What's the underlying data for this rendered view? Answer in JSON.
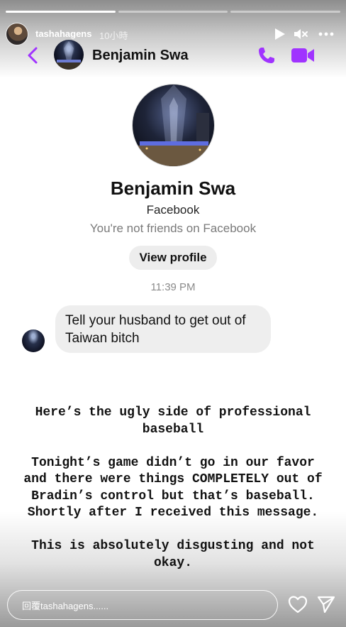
{
  "story": {
    "progress": [
      1.0,
      0.0,
      0.0
    ],
    "username": "tashahagens",
    "time_ago": "10小時",
    "reply_placeholder": "回覆tashahagens......"
  },
  "messenger": {
    "contact_name": "Benjamin Swa",
    "profile_name": "Benjamin Swa",
    "source": "Facebook",
    "relationship": "You're not friends on Facebook",
    "view_profile_label": "View profile",
    "timestamp": "11:39 PM",
    "message_text": "Tell your husband to get out of Taiwan bitch",
    "accent_color": "#a033ff"
  },
  "caption": {
    "text": "Here’s the ugly side of professional baseball\n\nTonight’s game didn’t go in our favor and there were things COMPLETELY out of Bradin’s control but that’s baseball. Shortly after I received this message.\n\nThis is absolutely disgusting and not okay."
  },
  "icons": {
    "play": "play-icon",
    "mute": "mute-icon",
    "more": "more-icon",
    "back": "back-icon",
    "call": "phone-icon",
    "video": "video-icon",
    "like": "heart-icon",
    "send": "send-icon"
  }
}
